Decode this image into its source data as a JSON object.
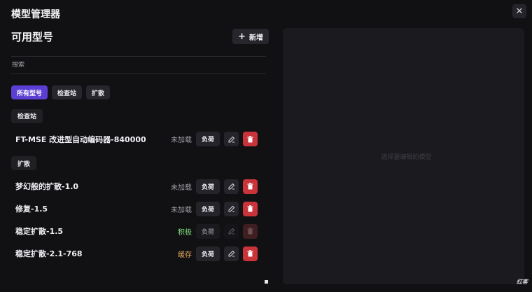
{
  "window": {
    "title": "模型管理器"
  },
  "header": {
    "title": "可用型号",
    "add_label": "新增"
  },
  "search": {
    "placeholder": "搜索"
  },
  "filters": [
    {
      "label": "所有型号",
      "active": true
    },
    {
      "label": "检查站",
      "active": false
    },
    {
      "label": "扩散",
      "active": false
    }
  ],
  "groups": {
    "checkpoint": {
      "label": "检查站"
    },
    "diffusion": {
      "label": "扩散"
    }
  },
  "models": [
    {
      "name": "FT-MSE 改进型自动编码器-840000",
      "status": "未加载",
      "load_label": "负荷"
    },
    {
      "name": "梦幻般的扩散-1.0",
      "status": "未加载",
      "load_label": "负荷"
    },
    {
      "name": "修复-1.5",
      "status": "未加载",
      "load_label": "负荷"
    },
    {
      "name": "稳定扩散-1.5",
      "status": "积极",
      "load_label": "负荷"
    },
    {
      "name": "稳定扩散-2.1-768",
      "status": "缓存",
      "load_label": "负荷"
    }
  ],
  "detail": {
    "placeholder": "选择要编辑的模型"
  },
  "watermark": "红客",
  "colors": {
    "accent": "#5b3fd4",
    "danger": "#c9343a",
    "active": "#7ee07a",
    "cached": "#e0a857"
  },
  "icons": {
    "close": "close-icon",
    "add": "plus-icon",
    "edit": "edit-icon",
    "delete": "trash-icon"
  }
}
